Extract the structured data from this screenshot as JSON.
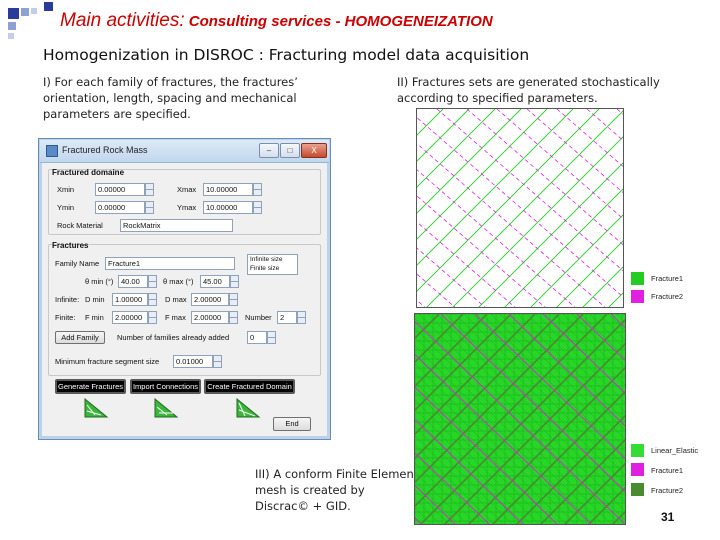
{
  "header": {
    "title_main": "Main activities:",
    "title_rest": " Consulting services - HOMOGENEIZATION",
    "subtitle": "Homogenization in DISROC : Fracturing model data acquisition",
    "colors": {
      "title": "#cc0000",
      "deco_blue": "#2a3b9c"
    }
  },
  "steps": {
    "step1": "I)  For each family of fractures, the fractures’ orientation, length, spacing and mechanical parameters are specified.",
    "step2": "II)  Fractures sets are generated stochastically according to specified parameters.",
    "step3": "III)  A conform Finite Element mesh is created by Discrac© + GID."
  },
  "dialog": {
    "title": "Fractured Rock Mass",
    "window_buttons": {
      "minimize": "–",
      "maximize": "□",
      "close": "X"
    },
    "domain_group": {
      "label": "Fractured domaine",
      "xmin_label": "Xmin",
      "xmin_value": "0.00000",
      "xmax_label": "Xmax",
      "xmax_value": "10.00000",
      "ymin_label": "Ymin",
      "ymin_value": "0.00000",
      "ymax_label": "Ymax",
      "ymax_value": "10.00000",
      "rock_material_label": "Rock Material",
      "rock_material_value": "RockMatrix"
    },
    "fractures_group": {
      "label": "Fractures",
      "family_name_label": "Family Name",
      "family_name_value": "Fracture1",
      "size_options": [
        "Infinite size",
        "Finite size"
      ],
      "theta_min_label": "θ min (°)",
      "theta_min_value": "40.00",
      "theta_max_label": "θ max (°)",
      "theta_max_value": "45.00",
      "infinite_label": "Infinite:",
      "dmin_label": "D min",
      "dmin_value": "1.00000",
      "dmax_label": "D max",
      "dmax_value": "2.00000",
      "finite_label": "Finite:",
      "fmin_label": "F min",
      "fmin_value": "2.00000",
      "fmax_label": "F max",
      "fmax_value": "2.00000",
      "number_label": "Number",
      "number_value": "2",
      "add_family_button": "Add Family",
      "families_count_label": "Number of families already added",
      "families_count_value": "0",
      "min_segment_label": "Minimum fracture segment size",
      "min_segment_value": "0.01000"
    },
    "action_buttons": [
      "Generate Fractures",
      "Import Connections",
      "Create Fractured Domain"
    ],
    "end_button": "End"
  },
  "legend_top": [
    {
      "label": "Fracture1",
      "color": "#22cc22"
    },
    {
      "label": "Fracture2",
      "color": "#e020e0"
    }
  ],
  "legend_bottom": [
    {
      "label": "Linear_Elastic",
      "color": "#33dd33"
    },
    {
      "label": "Fracture1",
      "color": "#e020e0"
    },
    {
      "label": "Fracture2",
      "color": "#4a8a30"
    }
  ],
  "page_number": "31"
}
